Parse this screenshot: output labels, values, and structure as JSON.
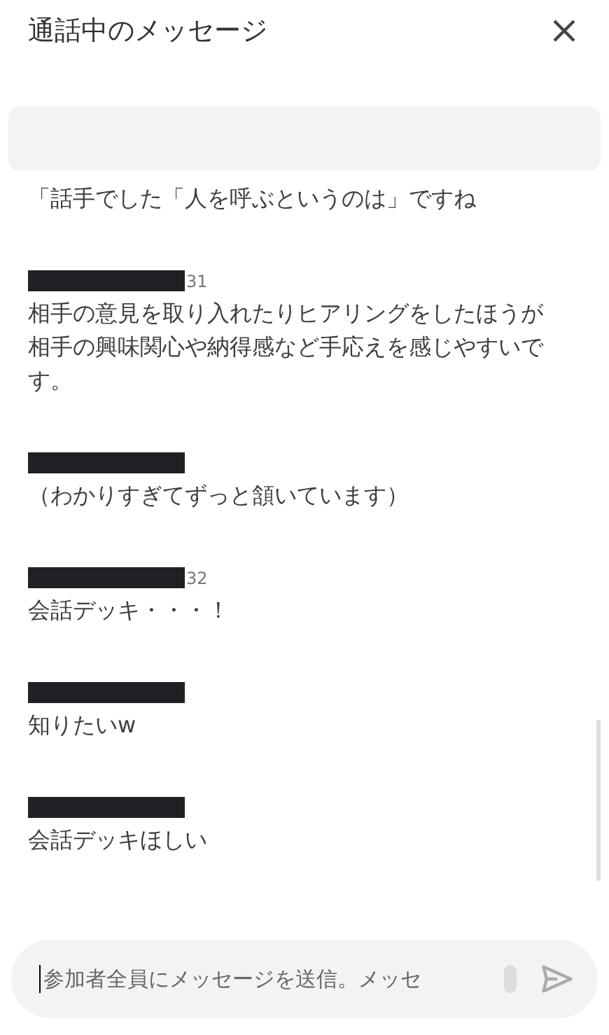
{
  "header": {
    "title": "通話中のメッセージ"
  },
  "messages": [
    {
      "redacted": false,
      "text": "「話手でした「人を呼ぶというのは」ですね"
    },
    {
      "redacted": true,
      "time": "31",
      "text": "相手の意見を取り入れたりヒアリングをしたほうが相手の興味関心や納得感など手応えを感じやすいです。"
    },
    {
      "redacted": true,
      "text": "（わかりすぎてずっと頷いています）"
    },
    {
      "redacted": true,
      "time": "32",
      "text": "会話デッキ・・・！"
    },
    {
      "redacted": true,
      "text": "知りたいw"
    },
    {
      "redacted": true,
      "text": "会話デッキほしい"
    }
  ],
  "composer": {
    "placeholder": "参加者全員にメッセージを送信。メッセ"
  }
}
